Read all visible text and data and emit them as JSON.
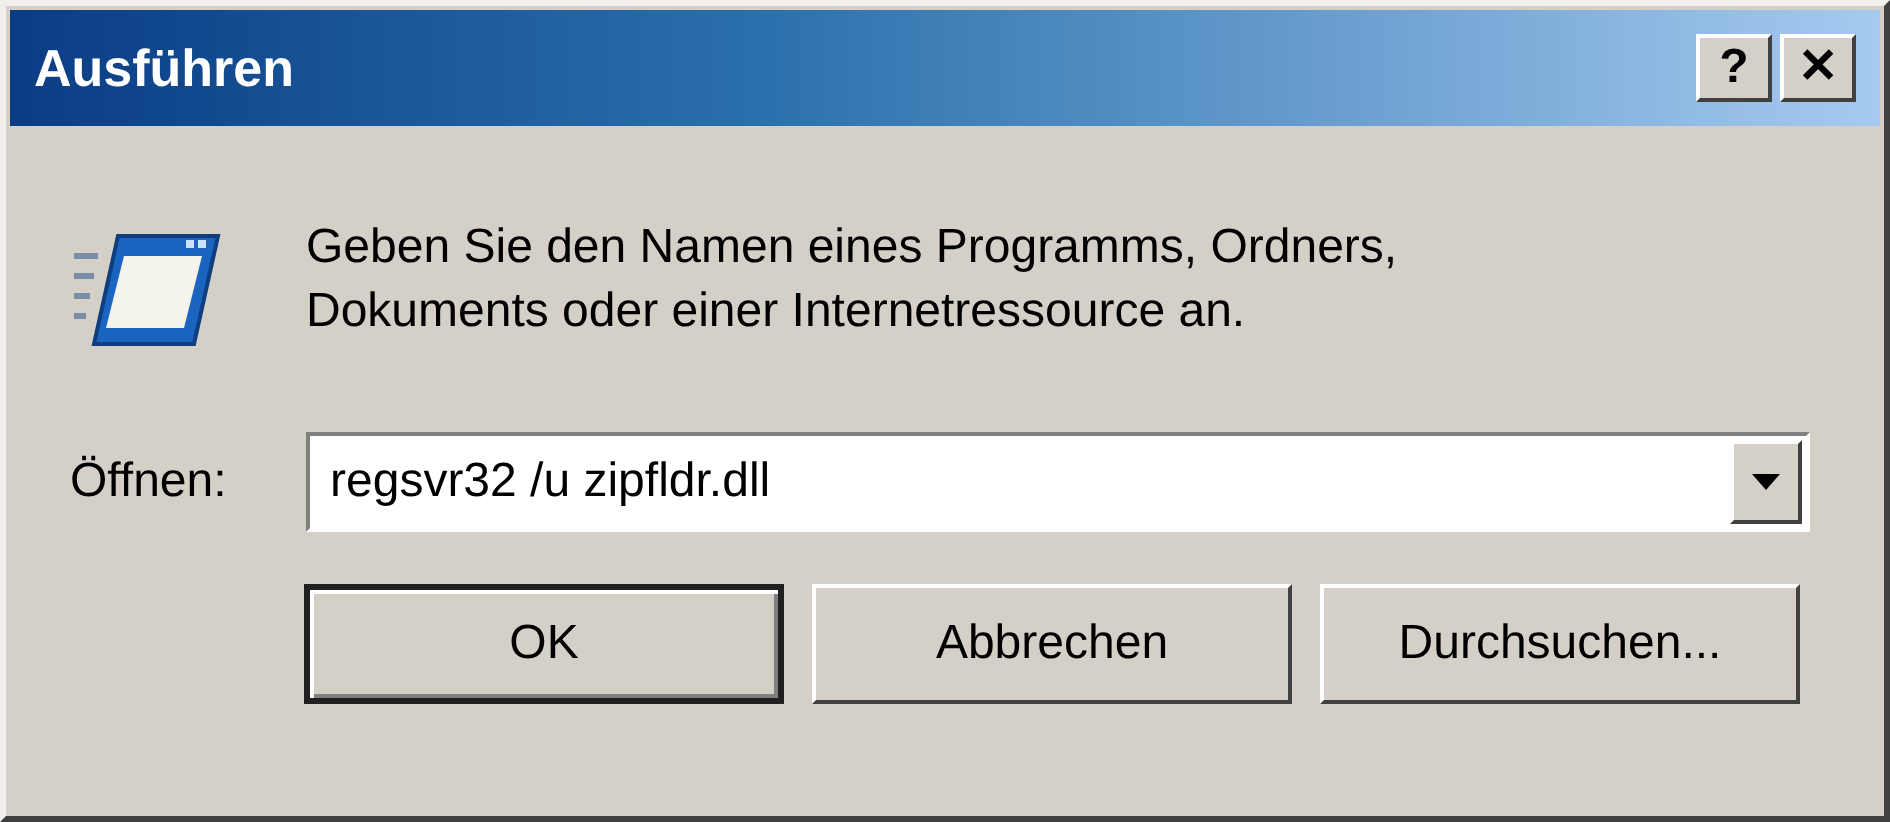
{
  "window": {
    "title": "Ausführen",
    "title_buttons": [
      {
        "label": "?"
      },
      {
        "label": "✕"
      }
    ]
  },
  "message": "Geben Sie den Namen eines Programms, Ordners, Dokuments oder einer Internetressource an.",
  "open_field": {
    "label": "Öffnen:",
    "value": "regsvr32 /u zipfldr.dll"
  },
  "buttons": [
    {
      "label": "OK",
      "default": true
    },
    {
      "label": "Abbrechen",
      "default": false
    },
    {
      "label": "Durchsuchen...",
      "default": false
    }
  ]
}
